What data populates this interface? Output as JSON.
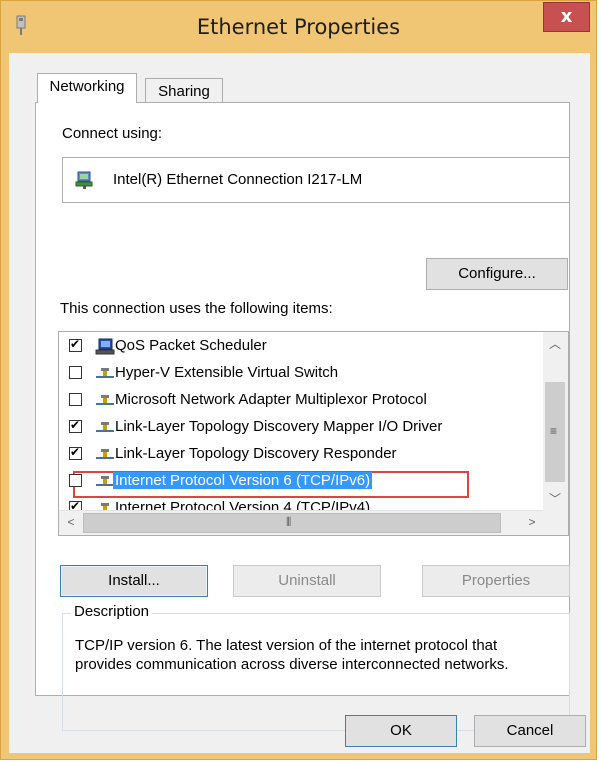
{
  "window": {
    "title": "Ethernet Properties",
    "close_glyph": "x"
  },
  "tabs": [
    {
      "label": "Networking",
      "active": true
    },
    {
      "label": "Sharing",
      "active": false
    }
  ],
  "networking": {
    "connect_using_label": "Connect using:",
    "adapter_name": "Intel(R) Ethernet Connection I217-LM",
    "configure_button": "Configure...",
    "items_label": "This connection uses the following items:",
    "items": [
      {
        "label": "QoS Packet Scheduler",
        "checked": true,
        "icon": "qos-scheduler-icon",
        "selected": false
      },
      {
        "label": "Hyper-V Extensible Virtual Switch",
        "checked": false,
        "icon": "network-protocol-icon",
        "selected": false
      },
      {
        "label": "Microsoft Network Adapter Multiplexor Protocol",
        "checked": false,
        "icon": "network-protocol-icon",
        "selected": false
      },
      {
        "label": "Link-Layer Topology Discovery Mapper I/O Driver",
        "checked": true,
        "icon": "network-protocol-icon",
        "selected": false
      },
      {
        "label": "Link-Layer Topology Discovery Responder",
        "checked": true,
        "icon": "network-protocol-icon",
        "selected": false
      },
      {
        "label": "Internet Protocol Version 6 (TCP/IPv6)",
        "checked": false,
        "icon": "network-protocol-icon",
        "selected": true
      },
      {
        "label": "Internet Protocol Version 4 (TCP/IPv4)",
        "checked": true,
        "icon": "network-protocol-icon",
        "selected": false
      }
    ],
    "install_button": "Install...",
    "uninstall_button": "Uninstall",
    "properties_button": "Properties",
    "description_legend": "Description",
    "description_text": "TCP/IP version 6. The latest version of the internet protocol that provides communication across diverse interconnected networks."
  },
  "footer": {
    "ok_button": "OK",
    "cancel_button": "Cancel"
  },
  "colors": {
    "titlebar": "#f0c674",
    "close_button": "#c75050",
    "selection": "#3399ff",
    "highlight_border": "#e04343"
  }
}
